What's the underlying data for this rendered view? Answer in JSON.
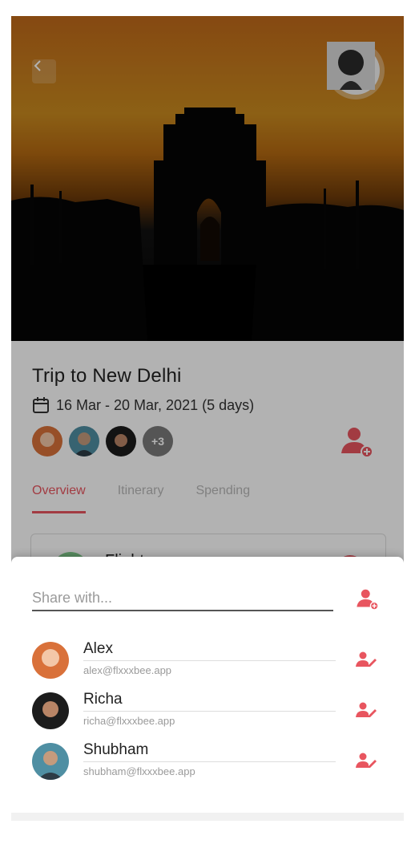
{
  "trip": {
    "title": "Trip to New Delhi",
    "dates": "16 Mar - 20 Mar, 2021 (5 days)",
    "more_members": "+3"
  },
  "tabs": [
    {
      "label": "Overview"
    },
    {
      "label": "Itinerary"
    },
    {
      "label": "Spending"
    }
  ],
  "cards": {
    "flights_label": "Flights"
  },
  "share": {
    "placeholder": "Share with..."
  },
  "people": [
    {
      "name": "Alex",
      "email": "alex@flxxxbee.app"
    },
    {
      "name": "Richa",
      "email": "richa@flxxxbee.app"
    },
    {
      "name": "Shubham",
      "email": "shubham@flxxxbee.app"
    }
  ],
  "icons": {
    "back": "chevron-left-icon",
    "calendar": "calendar-icon",
    "add_user": "add-user-icon",
    "edit_user": "edit-user-icon"
  },
  "colors": {
    "accent": "#e8555f",
    "overlay": "rgba(0,0,0,0.30)"
  }
}
